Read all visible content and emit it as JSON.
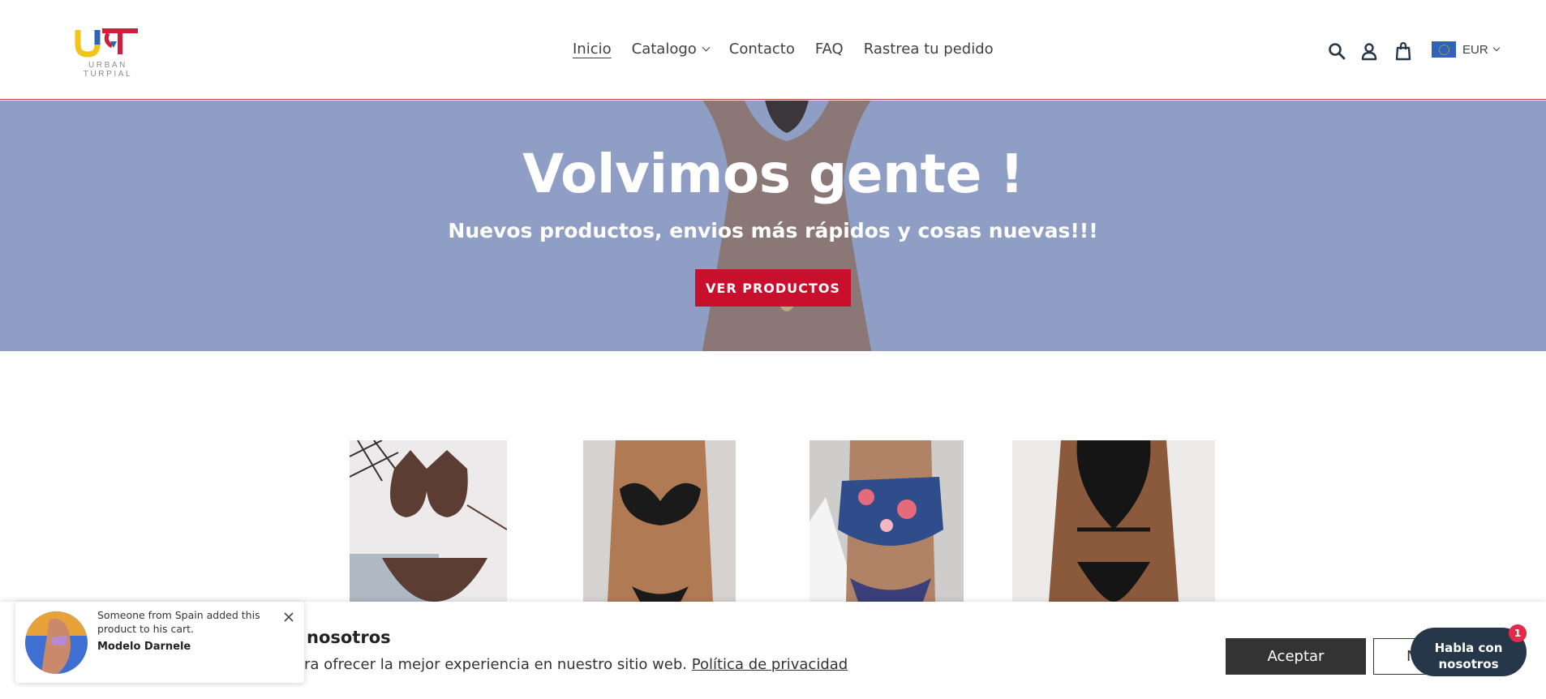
{
  "header": {
    "logo_text": "URBAN TURPIAL",
    "nav": [
      {
        "label": "Inicio"
      },
      {
        "label": "Catalogo"
      },
      {
        "label": "Contacto"
      },
      {
        "label": "FAQ"
      },
      {
        "label": "Rastrea tu pedido"
      }
    ],
    "icons": [
      "search-icon",
      "account-icon",
      "cart-icon"
    ],
    "currency": "EUR"
  },
  "hero": {
    "title": "Volvimos gente !",
    "subtitle": "Nuevos productos, envios más rápidos y cosas nuevas!!!",
    "button_label": "VER PRODUCTOS"
  },
  "cookie": {
    "title": "nosotros",
    "text": "ara ofrecer la mejor experiencia en nuestro sitio web.",
    "link_label": "Política de privacidad",
    "accept_label": "Aceptar",
    "decline_label": "N"
  },
  "popup": {
    "message": "Someone from Spain added this product to his cart.",
    "product": "Modelo Darnele"
  },
  "chat": {
    "label_line1": "Habla con",
    "label_line2": "nosotros",
    "badge": "1"
  },
  "colors": {
    "accent": "#c8102e",
    "hero_bg": "#8e9ec5",
    "chat_bg": "#26374a",
    "badge": "#e4294b"
  }
}
